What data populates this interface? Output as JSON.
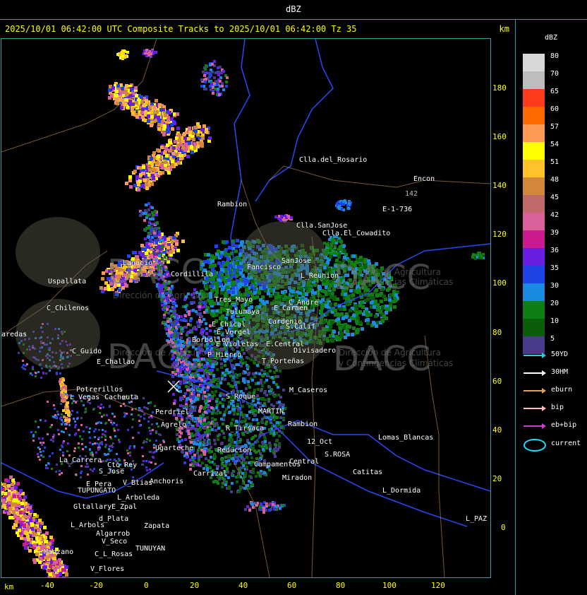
{
  "header": {
    "product": "dBZ"
  },
  "title": {
    "text": "2025/10/01 06:42:00 UTC Composite Tracks to 2025/10/01 06:42:00 Tz 35",
    "units": "km"
  },
  "axes": {
    "y_ticks": [
      "180",
      "160",
      "140",
      "120",
      "100",
      "80",
      "60",
      "40",
      "20",
      "0"
    ],
    "x_ticks": [
      "-40",
      "-20",
      "0",
      "20",
      "40",
      "60",
      "80",
      "100",
      "120"
    ],
    "x_unit": "km"
  },
  "legend": {
    "title": "dBZ",
    "bins": [
      {
        "label": "80",
        "color": "#d8d8d8"
      },
      {
        "label": "70",
        "color": "#bdbdbd"
      },
      {
        "label": "65",
        "color": "#ff3b1e"
      },
      {
        "label": "60",
        "color": "#ff6a00"
      },
      {
        "label": "57",
        "color": "#ff9a55"
      },
      {
        "label": "54",
        "color": "#ffff00"
      },
      {
        "label": "51",
        "color": "#ffc22a"
      },
      {
        "label": "48",
        "color": "#d2873a"
      },
      {
        "label": "45",
        "color": "#c06a6a"
      },
      {
        "label": "42",
        "color": "#d9609a"
      },
      {
        "label": "39",
        "color": "#cc1a8f"
      },
      {
        "label": "36",
        "color": "#6a1ee0"
      },
      {
        "label": "35",
        "color": "#1e44e8"
      },
      {
        "label": "30",
        "color": "#1a8ae0"
      },
      {
        "label": "20",
        "color": "#0f7f14"
      },
      {
        "label": "10",
        "color": "#0a5e0a"
      },
      {
        "label": "5",
        "color": "#4a3a8c"
      }
    ]
  },
  "tracks": [
    {
      "label": "50YD",
      "color": "#2ad0d0"
    },
    {
      "label": "30HM",
      "color": "#ffffff"
    },
    {
      "label": "eburn",
      "color": "#e0a060"
    },
    {
      "label": "bip",
      "color": "#ffbdbd"
    },
    {
      "label": "eb+bip",
      "color": "#d040d0"
    }
  ],
  "current_label": "current",
  "watermark": {
    "brand": "DACC",
    "line1": "Dirección de Agricultura",
    "line2": "y Contingencias Climáticas"
  },
  "places": [
    "Clla.del_Rosario",
    "Encon",
    "142",
    "E-1-736",
    "Rambion",
    "Clla.SanJose",
    "Clla.El_Cowadito",
    "SanJose",
    "L_Reunion",
    "Uspallata",
    "C_Chilenos",
    "aredas",
    "C_Guido",
    "E_Challao",
    "Tres_Mayo",
    "Tulumaya",
    "E_Carmen",
    "C_Andre",
    "E_Chical",
    "E_Vergel",
    "Cardenio",
    "S.Calif",
    "Borbollon",
    "E_Violetas",
    "E.Central",
    "Divisadero",
    "P_Hierro",
    "T_Porteñas",
    "Potrerillos",
    "Cacheuta",
    "L_Vegas",
    "M_Caseros",
    "S_Roque",
    "Perdriel",
    "Agrelo",
    "MARTIN",
    "R_Tirsaca",
    "Rambion",
    "Ugarteche",
    "Reducion",
    "12_Oct",
    "S.ROSA",
    "Lomas_Blancas",
    "La_Carrera",
    "Cto_Rey",
    "S_Jose",
    "Anchoris",
    "Carrizal",
    "Campamentos",
    "Central",
    "Catitas",
    "E_Pera",
    "TUPUNGATO",
    "V_Btias",
    "L_Arboleda",
    "Miradon",
    "L_Dormida",
    "Gltallary",
    "E_Zpal",
    "L_Arbols",
    "d_Plata",
    "Zapata",
    "L_PAZ",
    "Algarrob",
    "V_Seco",
    "TUNUYAN",
    "C_L_Rosas",
    "V_Flores",
    "Manzano",
    "Cordillila",
    "Lanacio",
    "Fancisco"
  ]
}
